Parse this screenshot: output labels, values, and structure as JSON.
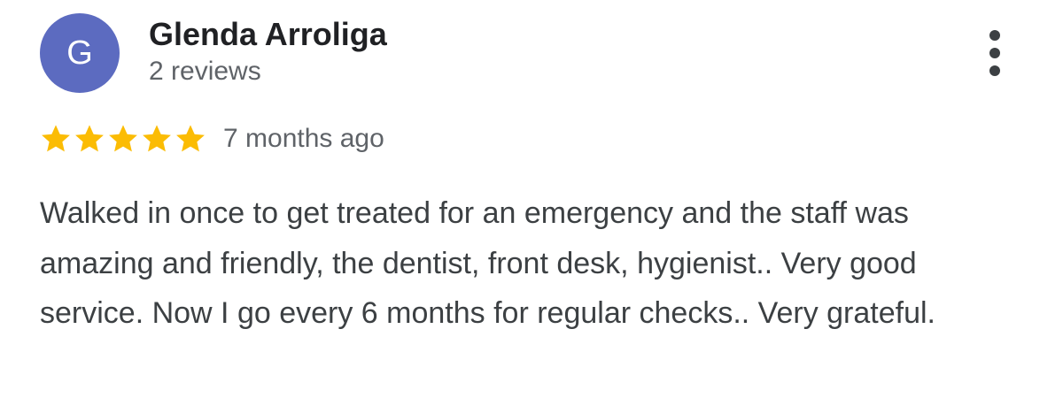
{
  "reviewer": {
    "initial": "G",
    "name": "Glenda Arroliga",
    "meta": "2 reviews",
    "avatar_color": "#5c6bc0"
  },
  "rating": {
    "stars": 5,
    "max_stars": 5,
    "star_color": "#fbbc04",
    "time_ago": "7 months ago"
  },
  "review": {
    "text": "Walked in once to get treated for an emergency and the staff was amazing and friendly, the dentist, front desk, hygienist.. Very good service. Now I go every 6 months for regular checks.. Very grateful."
  },
  "menu": {
    "icon": "more-vert-icon"
  }
}
